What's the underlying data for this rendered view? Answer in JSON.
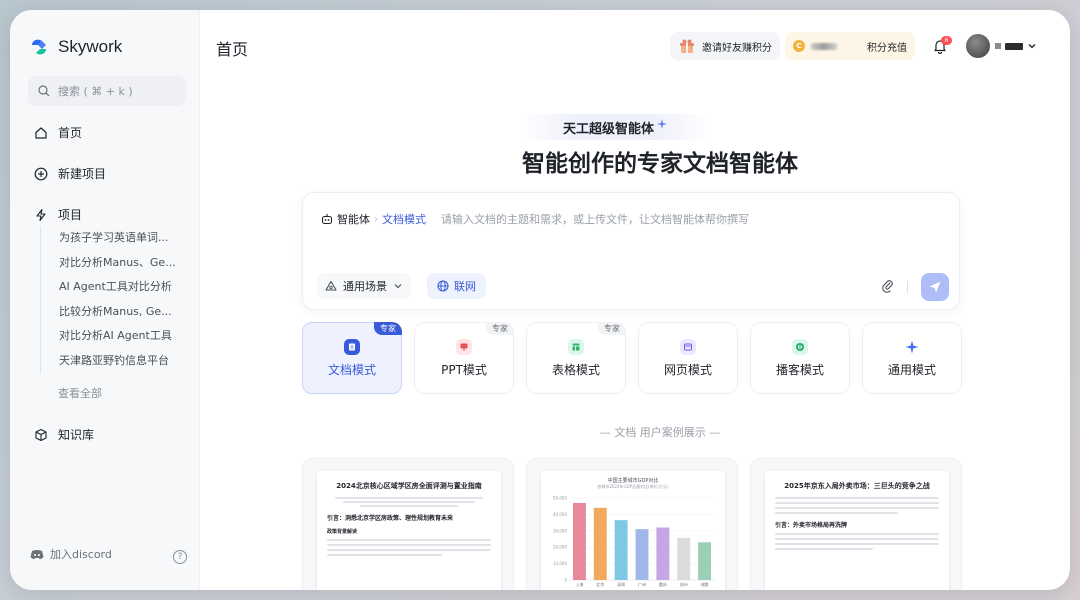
{
  "app": {
    "name": "Skywork"
  },
  "sidebar": {
    "search_placeholder": "搜索 ( ⌘ + k )",
    "nav": {
      "home": "首页",
      "new_project": "新建项目",
      "projects": "项目",
      "knowledge": "知识库"
    },
    "projects": [
      "为孩子学习英语单词...",
      "对比分析Manus、Ge...",
      "AI Agent工具对比分析",
      "比较分析Manus, Ge...",
      "对比分析AI Agent工具",
      "天津路亚野钓信息平台"
    ],
    "view_all": "查看全部",
    "discord": "加入discord",
    "help": "?"
  },
  "header": {
    "title": "首页",
    "invite": "邀请好友赚积分",
    "recharge": "积分充值",
    "notif_count": "6"
  },
  "hero": {
    "badge": "天工超级智能体",
    "title": "智能创作的专家文档智能体"
  },
  "input": {
    "agent_label": "智能体",
    "agent_mode": "文档模式",
    "placeholder": "请输入文档的主题和需求，或上传文件，让文档智能体帮你撰写",
    "scene": "通用场景",
    "network": "联网"
  },
  "modes": [
    {
      "label": "文档模式",
      "tag": "专家",
      "active": true,
      "color": "#3a5bd9"
    },
    {
      "label": "PPT模式",
      "tag": "专家",
      "color": "#e8505b"
    },
    {
      "label": "表格模式",
      "tag": "专家",
      "color": "#2fb36b"
    },
    {
      "label": "网页模式",
      "tag": "",
      "color": "#7b5cf0"
    },
    {
      "label": "播客模式",
      "tag": "",
      "color": "#1fae6a"
    },
    {
      "label": "通用模式",
      "tag": "",
      "color": "#4b6cf0"
    }
  ],
  "cases": {
    "title": "— 文档 用户案例展示 —",
    "items": [
      {
        "title": "2024北京核心区域学区房全面评测与置业指南",
        "heading": "引言：洞悉北京学区房政策、理性规划教育未来",
        "section": "政策背景解读"
      },
      {
        "title": "中国主要城市GDP对比",
        "subtitle": "各城市2024年GDP总量对比(单位:亿元)"
      },
      {
        "title": "2025年京东入局外卖市场：三巨头的竞争之战",
        "heading": "引言：外卖市场格局再洗牌"
      }
    ]
  },
  "chart_data": {
    "type": "bar",
    "title": "中国主要城市GDP对比",
    "categories": [
      "上海",
      "北京",
      "深圳",
      "广州",
      "重庆",
      "苏州",
      "成都"
    ],
    "values": [
      47000,
      44000,
      36500,
      31000,
      32000,
      25700,
      23000
    ],
    "colors": [
      "#e8899a",
      "#f2a95c",
      "#7ec8e3",
      "#9fb8e8",
      "#c7a6e8",
      "#dcdcdc",
      "#9bd0b6"
    ],
    "ylim": [
      0,
      50000
    ]
  }
}
